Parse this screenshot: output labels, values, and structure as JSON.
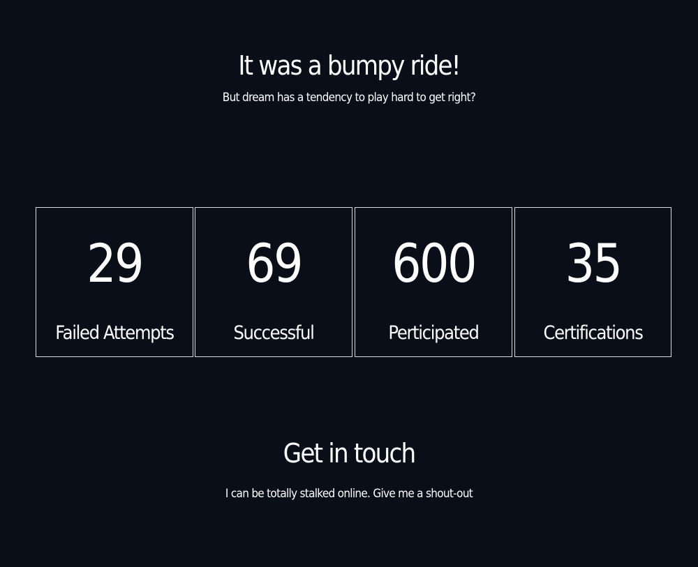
{
  "stats_section": {
    "title": "It was a bumpy ride!",
    "subtitle": "But dream has a tendency to play hard to get right?",
    "stats": [
      {
        "value": "29",
        "label": "Failed Attempts"
      },
      {
        "value": "69",
        "label": "Successful"
      },
      {
        "value": "600",
        "label": "Perticipated"
      },
      {
        "value": "35",
        "label": "Certifications"
      }
    ]
  },
  "contact_section": {
    "title": "Get in touch",
    "subtitle": "I can be totally stalked online. Give me a shout-out"
  },
  "colors": {
    "background": "#0a0e18",
    "text": "#ffffff",
    "card_border": "#d8dce4"
  }
}
